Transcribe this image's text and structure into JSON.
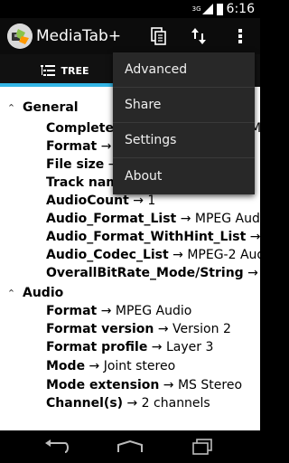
{
  "status_bar": {
    "network": "3G",
    "time": "6:16"
  },
  "app": {
    "title": "MediaTab+"
  },
  "toolbar": {
    "copy_icon": "copy-icon",
    "sort_icon": "sort-icon",
    "overflow_icon": "more-vert-icon"
  },
  "tabs": [
    {
      "label": "TREE",
      "icon": "tree-icon",
      "selected": true
    }
  ],
  "accent_color": "#33b5e5",
  "tree": {
    "general": {
      "label": "General",
      "rows": [
        {
          "key": "Complete n",
          "value": ""
        },
        {
          "key": "Format",
          "value": "→ M"
        },
        {
          "key": "File size",
          "value": "→"
        },
        {
          "key": "Track name",
          "value": ""
        },
        {
          "key": "AudioCount",
          "value": "→ 1"
        },
        {
          "key": "Audio_Format_List",
          "value": "→ MPEG Audio"
        },
        {
          "key": "Audio_Format_WithHint_List",
          "value": "→ MPEG"
        },
        {
          "key": "Audio_Codec_List",
          "value": "→ MPEG-2 Audio l"
        },
        {
          "key": "OverallBitRate_Mode/String",
          "value": "→ Varial"
        }
      ]
    },
    "audio": {
      "label": "Audio",
      "rows": [
        {
          "key": "Format",
          "value": "→ MPEG Audio"
        },
        {
          "key": "Format version",
          "value": "→ Version 2"
        },
        {
          "key": "Format profile",
          "value": "→ Layer 3"
        },
        {
          "key": "Mode",
          "value": "→ Joint stereo"
        },
        {
          "key": "Mode extension",
          "value": "→ MS Stereo"
        },
        {
          "key": "Channel(s)",
          "value": "→ 2 channels"
        }
      ]
    },
    "truncated_tail": "M"
  },
  "menu": {
    "items": [
      "Advanced",
      "Share",
      "Settings",
      "About"
    ]
  },
  "nav": {
    "back_icon": "back-icon",
    "home_icon": "home-icon",
    "recent_icon": "recent-apps-icon"
  }
}
